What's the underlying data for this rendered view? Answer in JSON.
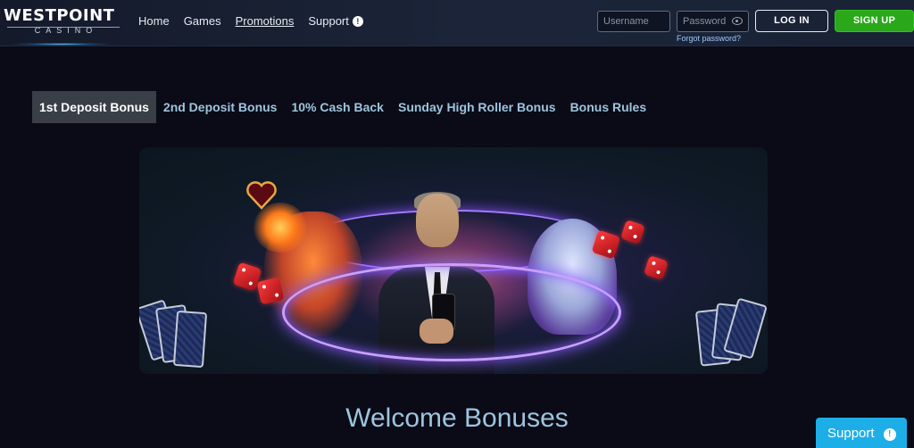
{
  "header": {
    "logo_main": "WESTPOINT",
    "logo_sub": "CASINO",
    "nav": [
      {
        "label": "Home"
      },
      {
        "label": "Games"
      },
      {
        "label": "Promotions",
        "active": true
      },
      {
        "label": "Support",
        "badge": "!"
      }
    ],
    "username_placeholder": "Username",
    "password_placeholder": "Password",
    "forgot_password": "Forgot password?",
    "login_label": "LOG IN",
    "signup_label": "SIGN UP"
  },
  "tabs": [
    {
      "label": "1st Deposit Bonus",
      "active": true
    },
    {
      "label": "2nd Deposit Bonus"
    },
    {
      "label": "10% Cash Back"
    },
    {
      "label": "Sunday High Roller Bonus"
    },
    {
      "label": "Bonus Rules"
    }
  ],
  "main": {
    "heading": "Welcome Bonuses"
  },
  "support_widget": {
    "label": "Support",
    "badge": "!"
  },
  "colors": {
    "accent": "#9ec4de",
    "signup": "#2aa81a",
    "support": "#1daee8",
    "background": "#0a0b16"
  }
}
